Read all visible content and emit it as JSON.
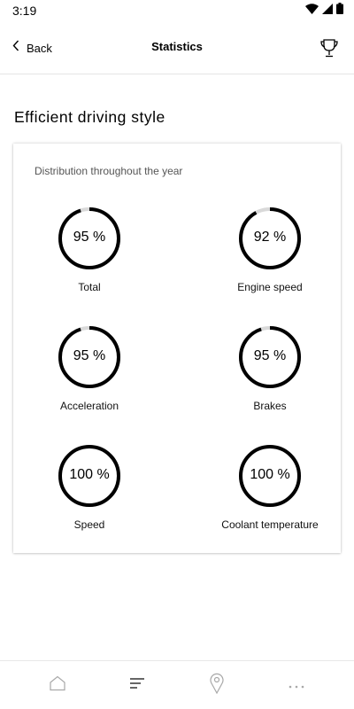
{
  "status_bar": {
    "time": "3:19",
    "icons": [
      "wifi-icon",
      "cellular-icon",
      "battery-icon"
    ]
  },
  "header": {
    "back_label": "Back",
    "title": "Statistics",
    "right_icon": "trophy-icon"
  },
  "section": {
    "title": "Efficient driving style"
  },
  "card": {
    "subtitle": "Distribution throughout the year",
    "gauges": [
      {
        "label": "Total",
        "value_text": "95 %",
        "percent": 95
      },
      {
        "label": "Engine speed",
        "value_text": "92 %",
        "percent": 92
      },
      {
        "label": "Acceleration",
        "value_text": "95 %",
        "percent": 95
      },
      {
        "label": "Brakes",
        "value_text": "95 %",
        "percent": 95
      },
      {
        "label": "Speed",
        "value_text": "100 %",
        "percent": 100
      },
      {
        "label": "Coolant temperature",
        "value_text": "100 %",
        "percent": 100
      }
    ]
  },
  "bottom_nav": {
    "items": [
      {
        "icon": "home-icon",
        "active": false
      },
      {
        "icon": "list-icon",
        "active": true
      },
      {
        "icon": "map-pin-icon",
        "active": false
      },
      {
        "icon": "more-icon",
        "active": false
      }
    ]
  },
  "colors": {
    "gauge_fill": "#000000",
    "gauge_track": "#d9d9d9",
    "nav_active": "#333333",
    "nav_inactive": "#a8a8a8"
  }
}
